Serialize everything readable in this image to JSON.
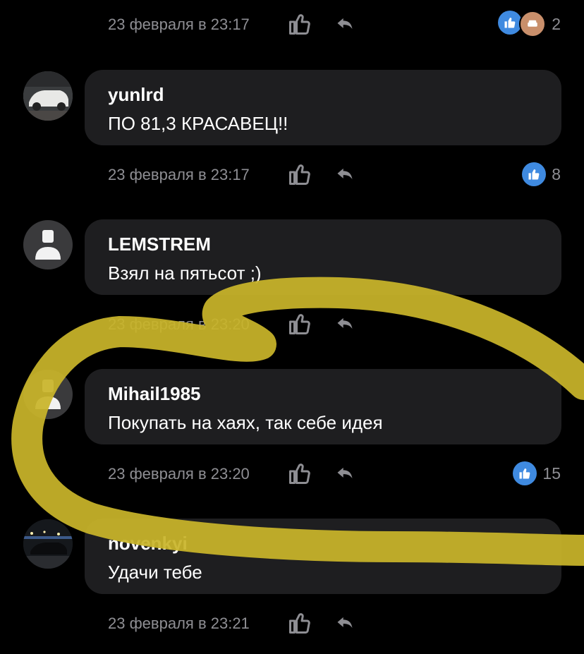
{
  "top_meta": {
    "time": "23 февраля в 23:17",
    "reactions_count": "2",
    "reaction_icons": [
      "thumbs-up-icon",
      "couch-icon"
    ]
  },
  "comments": [
    {
      "author": "yunlrd",
      "text": "ПО 81,3 КРАСАВЕЦ!!",
      "time": "23 февраля в 23:17",
      "likes": "8",
      "avatar": "car-photo"
    },
    {
      "author": "LEMSTREM",
      "text": "Взял на пятьсот ;)",
      "time": "23 февраля в 23:20",
      "likes": "",
      "avatar": "default-user-icon"
    },
    {
      "author": "Mihail1985",
      "text": "Покупать на хаях, так себе идея",
      "time": "23 февраля в 23:20",
      "likes": "15",
      "avatar": "default-user-icon"
    },
    {
      "author": "novenkyi",
      "text": "Удачи тебе",
      "time": "23 февраля в 23:21",
      "likes": "",
      "avatar": "car-photo"
    }
  ],
  "colors": {
    "background": "#000000",
    "bubble": "#1e1e20",
    "meta": "#8e8e93",
    "like_blue": "#3f8ae0",
    "highlighter": "#c9b52a"
  }
}
